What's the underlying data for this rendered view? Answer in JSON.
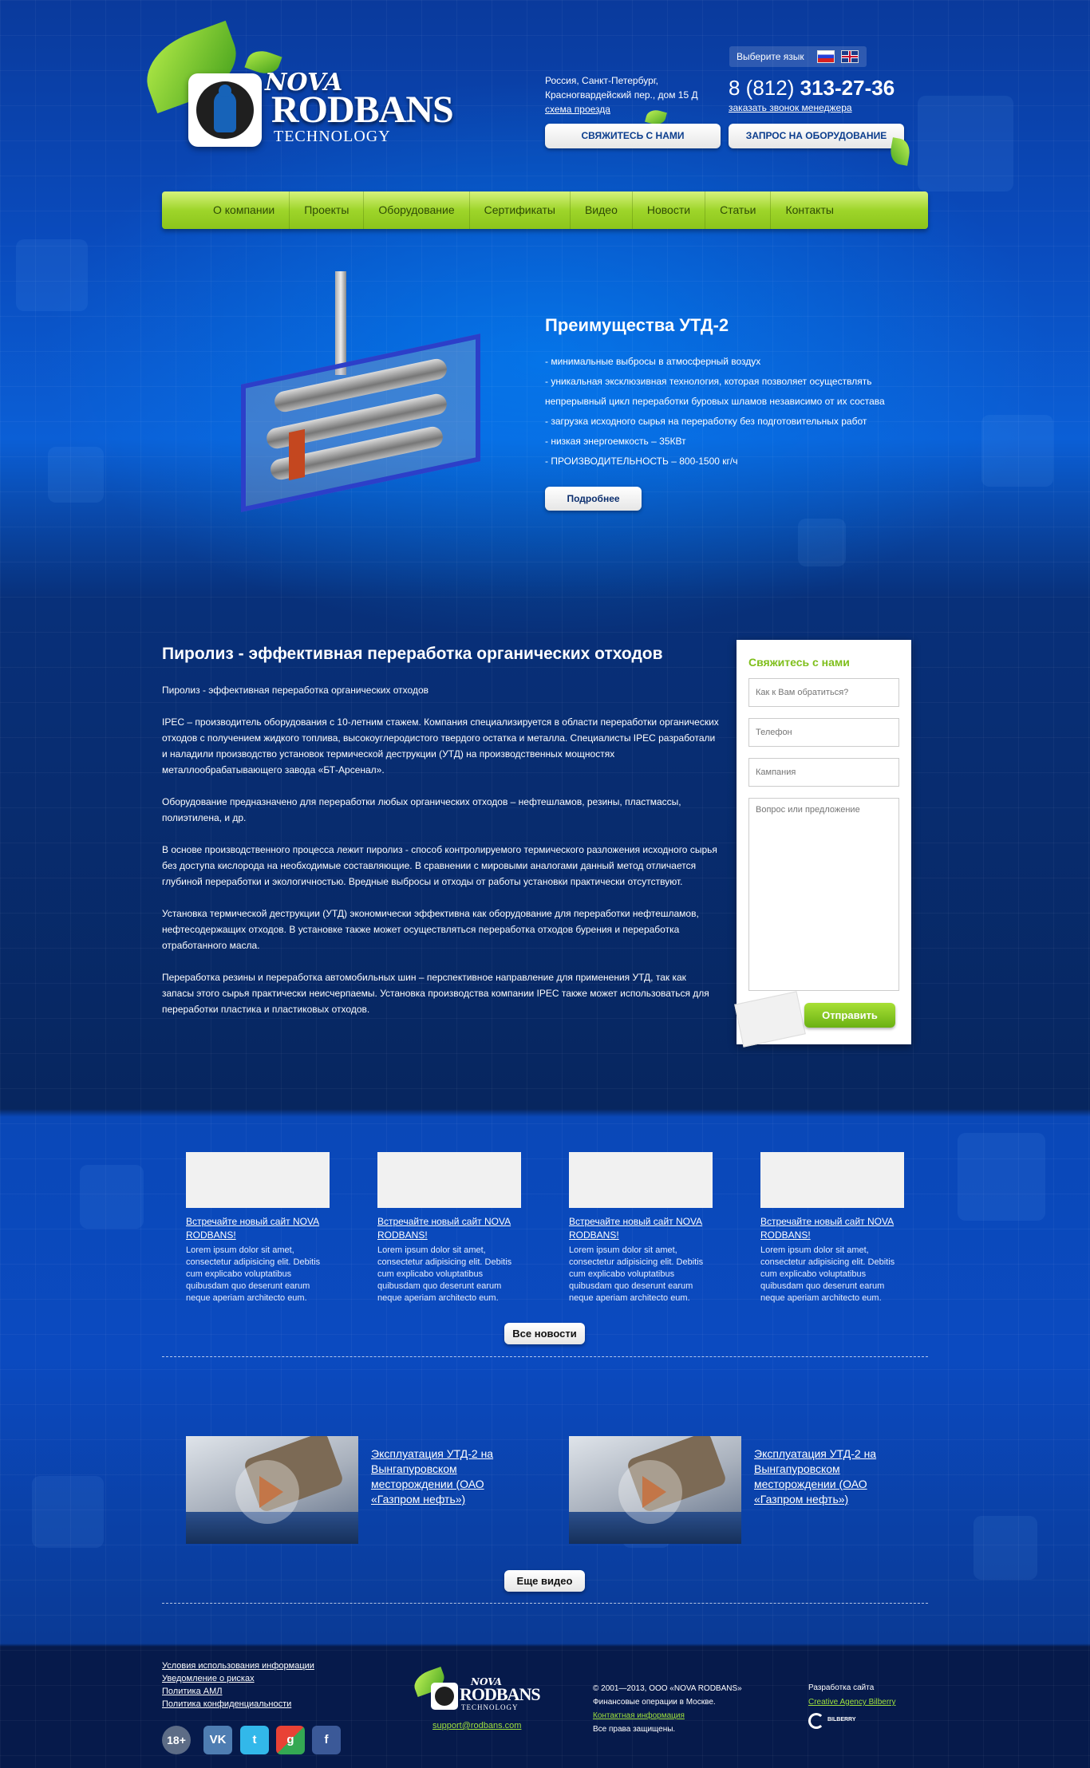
{
  "header": {
    "logo": {
      "line1": "NOVA",
      "line2": "RODBANS",
      "line3": "TECHNOLOGY"
    },
    "address": {
      "line1": "Россия, Санкт-Петербург,",
      "line2": "Красногвардейский пер., дом 15 Д",
      "map_link": "схема проезда"
    },
    "language": {
      "label": "Выберите язык",
      "flags": [
        "flag-ru-icon",
        "flag-uk-icon"
      ]
    },
    "phone": {
      "prefix": "8 (812)",
      "number": "313-27-36"
    },
    "callback_link": "заказать звонок менеджера",
    "contact_button": "СВЯЖИТЕСЬ С НАМИ",
    "request_button": "ЗАПРОС НА ОБОРУДОВАНИЕ"
  },
  "nav": {
    "items": [
      {
        "label": "О компании"
      },
      {
        "label": "Проекты"
      },
      {
        "label": "Оборудование"
      },
      {
        "label": "Сертификаты"
      },
      {
        "label": "Видео"
      },
      {
        "label": "Новости"
      },
      {
        "label": "Статьи"
      },
      {
        "label": "Контакты"
      }
    ]
  },
  "hero": {
    "title": "Преимущества УТД-2",
    "points": [
      "-  минимальные выбросы в атмосферный воздух",
      "-  уникальная эксклюзивная технология, которая позволяет осуществлять непрерывный цикл переработки буровых шламов независимо от их состава",
      "-  загрузка исходного сырья на переработку без подготовительных работ",
      "-  низкая энергоемкость – 35КВт",
      "-  ПРОИЗВОДИТЕЛЬНОСТЬ – 800-1500 кг/ч"
    ],
    "more_button": "Подробнее"
  },
  "main": {
    "title": "Пиролиз - эффективная переработка органических отходов",
    "paragraphs": [
      "Пиролиз - эффективная переработка органических отходов",
      "IPEC – производитель оборудования с 10-летним стажем. Компания специализируется в области переработки органических отходов с получением жидкого топлива, высокоуглеродистого твердого остатка и металла. Специалисты IPEC разработали и наладили производство установок термической деструкции (УТД) на производственных мощностях металлообрабатывающего завода «БТ-Арсенал».",
      "Оборудование предназначено для переработки любых органических отходов – нефтешламов, резины, пластмассы, полиэтилена, и др.",
      "В основе производственного процесса лежит пиролиз - способ контролируемого термического разложения исходного сырья без доступа кислорода на необходимые составляющие. В сравнении с мировыми аналогами данный метод отличается глубиной переработки и экологичностью. Вредные выбросы и отходы от работы установки практически отсутствуют.",
      "Установка термической деструкции (УТД) экономически эффективна как оборудование для переработки нефтешламов, нефтесодержащих отходов. В установке также может осуществляться переработка отходов бурения и переработка отработанного масла.",
      "Переработка резины и переработка автомобильных шин – перспективное направление для применения УТД, так как запасы этого сырья практически неисчерпаемы. Установка производства компании IPEC также может использоваться для переработки пластика и пластиковых отходов."
    ]
  },
  "form": {
    "title": "Свяжитесь с нами",
    "name_placeholder": "Как к Вам обратиться?",
    "phone_placeholder": "Телефон",
    "company_placeholder": "Кампания",
    "question_placeholder": "Вопрос или предложение",
    "submit": "Отправить"
  },
  "news": {
    "items": [
      {
        "title": "Встречайте новый сайт NOVA RODBANS!",
        "text": "Lorem ipsum dolor sit amet, consectetur adipisicing elit. Debitis cum explicabo voluptatibus quibusdam quo deserunt earum neque aperiam architecto eum."
      },
      {
        "title": "Встречайте новый сайт NOVA RODBANS!",
        "text": "Lorem ipsum dolor sit amet, consectetur adipisicing elit. Debitis cum explicabo voluptatibus quibusdam quo deserunt earum neque aperiam architecto eum."
      },
      {
        "title": "Встречайте новый сайт NOVA RODBANS!",
        "text": "Lorem ipsum dolor sit amet, consectetur adipisicing elit. Debitis cum explicabo voluptatibus quibusdam quo deserunt earum neque aperiam architecto eum."
      },
      {
        "title": "Встречайте новый сайт NOVA RODBANS!",
        "text": "Lorem ipsum dolor sit amet, consectetur adipisicing elit. Debitis cum explicabo voluptatibus quibusdam quo deserunt earum neque aperiam architecto eum."
      }
    ],
    "all_button": "Все новости"
  },
  "videos": {
    "items": [
      {
        "title": "Эксплуатация УТД-2 на Вынгапуровском месторождении (ОАО «Газпром нефть»)"
      },
      {
        "title": "Эксплуатация УТД-2 на Вынгапуровском месторождении (ОАО «Газпром нефть»)"
      }
    ],
    "more_button": "Еще видео"
  },
  "footer": {
    "links": [
      "Условия использования информации",
      "Уведомление о рисках",
      "Политика АМЛ",
      "Политика конфиденциальности"
    ],
    "social": {
      "age": "18+",
      "vk": "VK",
      "twitter": "twitter-icon",
      "google": "google-plus-icon",
      "facebook": "facebook-icon"
    },
    "logo": {
      "line1": "NOVA",
      "line2": "RODBANS",
      "line3": "TECHNOLOGY"
    },
    "email": "support@rodbans.com",
    "copyright": "© 2001—2013, ООО «NOVA RODBANS»",
    "finance": "Финансовые операции в Москве.",
    "contact_link": "Контактная информация",
    "rights": "Все права защищены.",
    "dev_label": "Разработка сайта",
    "dev_link": "Creative Agency Bilberry",
    "dev_logo": "BILBERRY"
  }
}
